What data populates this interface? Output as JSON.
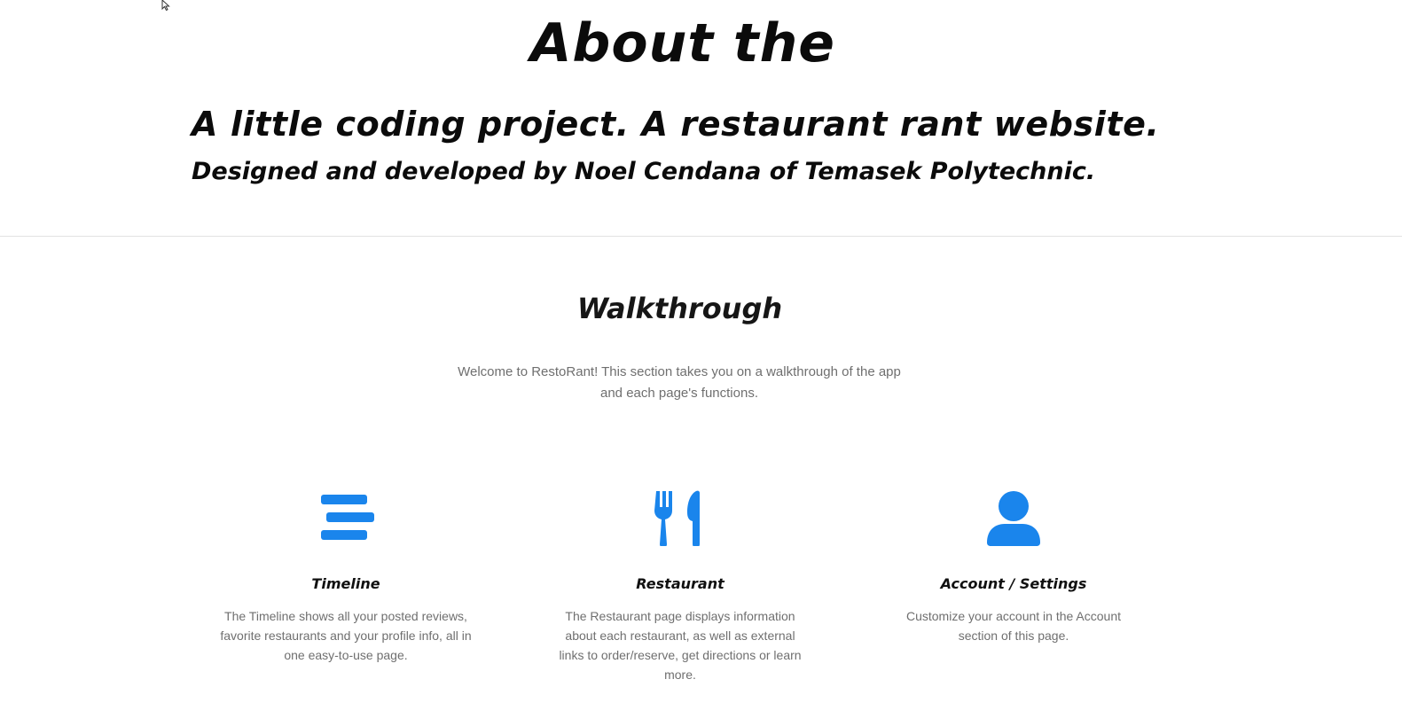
{
  "hero": {
    "title": "About the",
    "subtitle": "A little coding project. A restaurant rant website.",
    "credit": "Designed and developed by Noel Cendana of Temasek Polytechnic."
  },
  "walkthrough": {
    "title": "Walkthrough",
    "intro": "Welcome to RestoRant! This section takes you on a walkthrough of the app and each page's functions."
  },
  "features": [
    {
      "icon": "list-icon",
      "title": "Timeline",
      "description": "The Timeline shows all your posted reviews, favorite restaurants and your profile info, all in one easy-to-use page."
    },
    {
      "icon": "utensils-icon",
      "title": "Restaurant",
      "description": "The Restaurant page displays information about each restaurant, as well as external links to order/reserve, get directions or learn more."
    },
    {
      "icon": "user-icon",
      "title": "Account / Settings",
      "description": "Customize your account in the Account section of this page."
    }
  ],
  "colors": {
    "accent": "#1a85ec",
    "heading": "#111111",
    "muted_text": "#6f6f6f",
    "divider": "#e2e2e2",
    "background": "#ffffff"
  }
}
